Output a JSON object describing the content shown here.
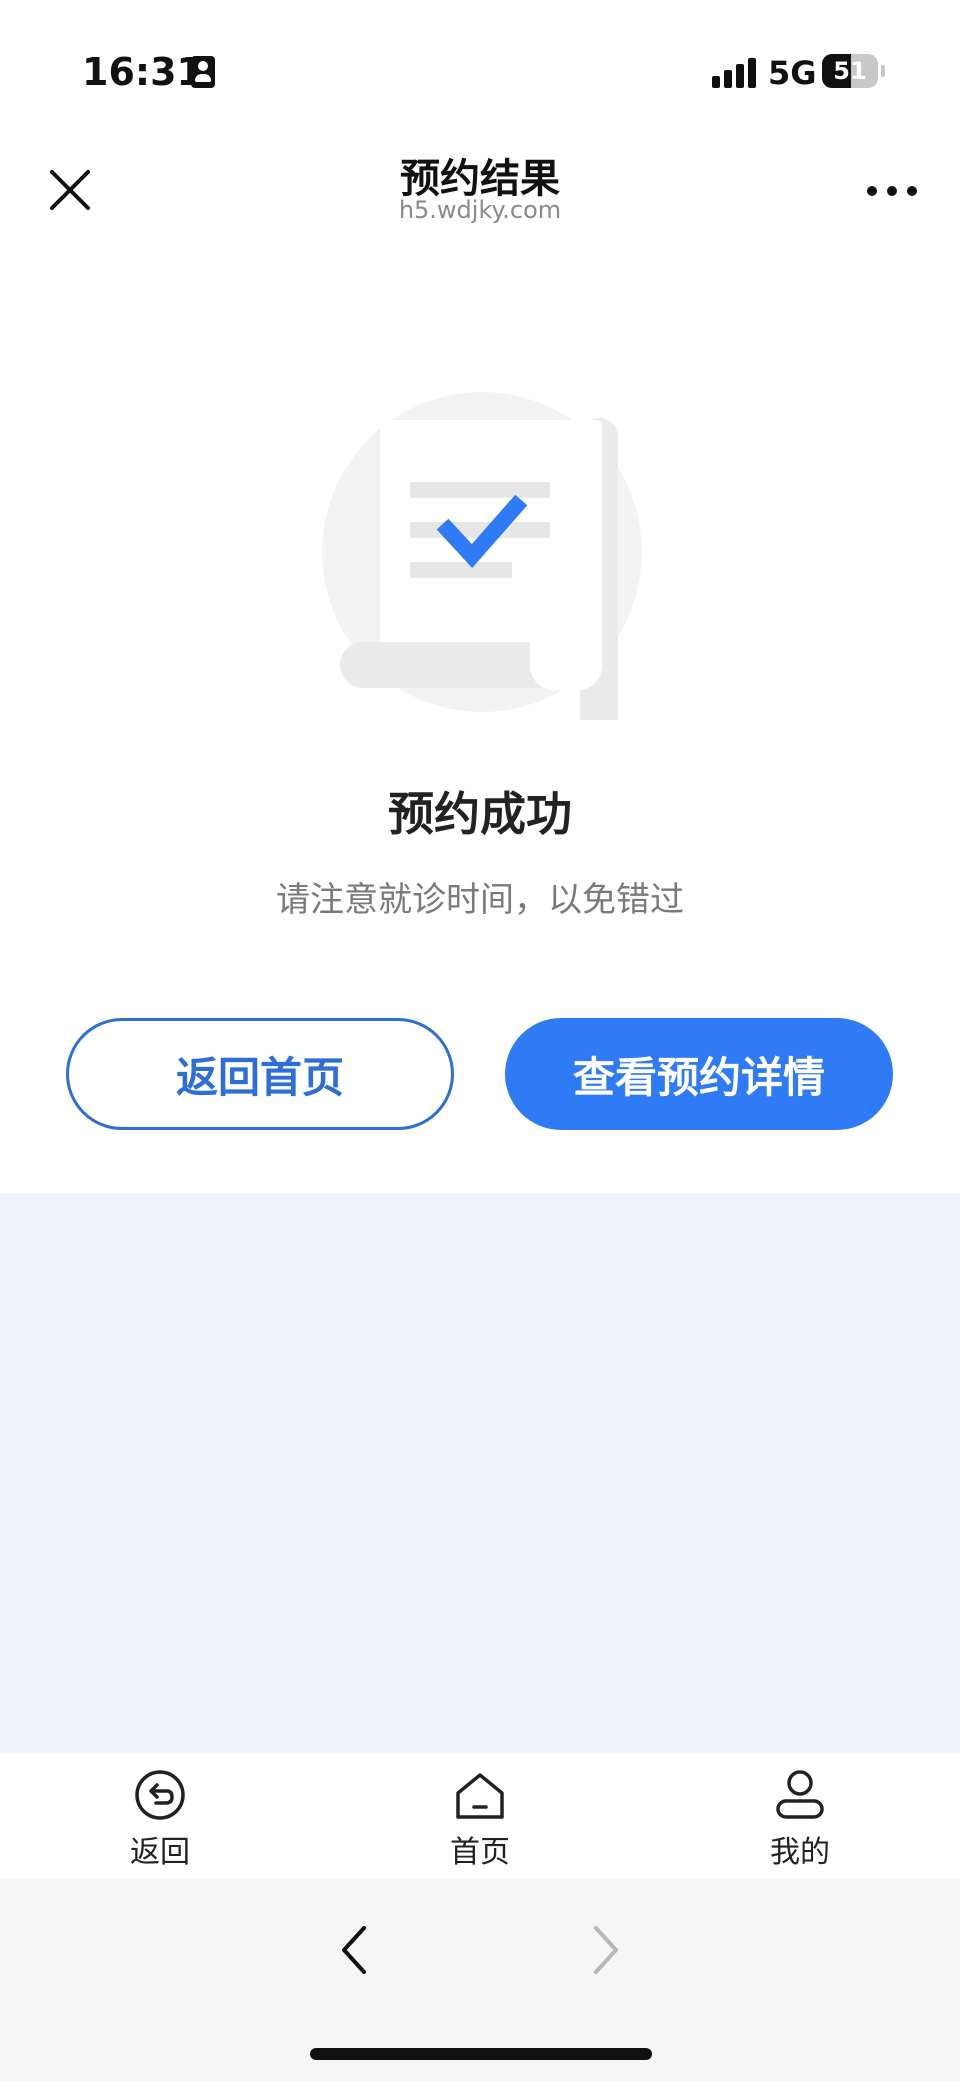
{
  "status_bar": {
    "time": "16:31",
    "network": "5G",
    "battery_level": "51",
    "battery_fraction": 0.51
  },
  "nav": {
    "title": "预约结果",
    "url": "h5.wdjky.com"
  },
  "result": {
    "title": "预约成功",
    "subtitle": "请注意就诊时间，以免错过"
  },
  "actions": {
    "home_label": "返回首页",
    "detail_label": "查看预约详情"
  },
  "tab_bar": {
    "items": [
      {
        "label": "返回",
        "icon": "back-circle-icon"
      },
      {
        "label": "首页",
        "icon": "home-icon"
      },
      {
        "label": "我的",
        "icon": "user-icon"
      }
    ]
  },
  "colors": {
    "primary": "#2f7bf5",
    "outline": "#2d6fd6",
    "content_bg": "#eff4fd"
  }
}
